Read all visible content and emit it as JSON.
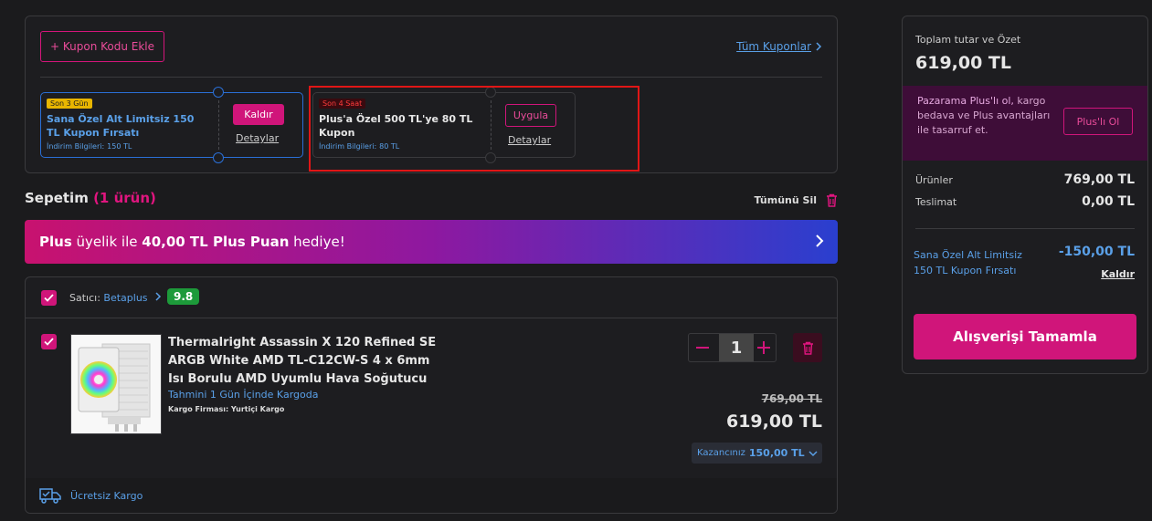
{
  "coupons": {
    "add_label": "+ Kupon Kodu Ekle",
    "all_label": "Tüm Kuponlar",
    "items": [
      {
        "tag": "Son 3 Gün",
        "title": "Sana Özel Alt Limitsiz 150 TL Kupon Fırsatı",
        "info_label": "İndirim Bilgileri:",
        "info_value": "150 TL",
        "action_label": "Kaldır",
        "detail_label": "Detaylar"
      },
      {
        "tag": "Son 4 Saat",
        "title": "Plus'a Özel 500 TL'ye 80 TL Kupon",
        "info_label": "İndirim Bilgileri:",
        "info_value": "80 TL",
        "action_label": "Uygula",
        "detail_label": "Detaylar"
      }
    ]
  },
  "cart": {
    "title": "Sepetim",
    "count": "(1 ürün)",
    "delete_all": "Tümünü Sil"
  },
  "plus_banner": {
    "part1": "Plus",
    "part2": " üyelik ile ",
    "part3": "40,00 TL Plus Puan",
    "part4": " hediye!"
  },
  "seller": {
    "label": "Satıcı:",
    "name": "Betaplus",
    "score": "9.8"
  },
  "product": {
    "name": "Thermalright Assassin X 120 Refined SE ARGB White AMD TL-C12CW-S 4 x 6mm Isı Borulu AMD Uyumlu Hava Soğutucu",
    "shipping": "Tahmini 1 Gün İçinde Kargoda",
    "cargo": "Kargo Firması: Yurtiçi Kargo",
    "quantity": "1",
    "old_price": "769,00 TL",
    "new_price": "619,00 TL",
    "savings_label": "Kazancınız",
    "savings_value": "150,00 TL",
    "free_shipping": "Ücretsiz Kargo"
  },
  "summary": {
    "label": "Toplam tutar ve Özet",
    "total": "619,00 TL",
    "plus_promo_bold": "Pazarama Plus'lı ol,",
    "plus_promo_rest": " kargo bedava ve Plus avantajları ile tasarruf et.",
    "plus_btn": "Plus'lı Ol",
    "products_label": "Ürünler",
    "products_value": "769,00 TL",
    "delivery_label": "Teslimat",
    "delivery_value": "0,00 TL",
    "discount_label": "Sana Özel Alt Limitsiz 150 TL Kupon Fırsatı",
    "discount_value": "-150,00 TL",
    "discount_remove": "Kaldır",
    "checkout": "Alışverişi Tamamla"
  },
  "colors": {
    "accent": "#d0157a",
    "link": "#5aa0e8",
    "background": "#1b1b1d",
    "highlight": "#e01616"
  }
}
